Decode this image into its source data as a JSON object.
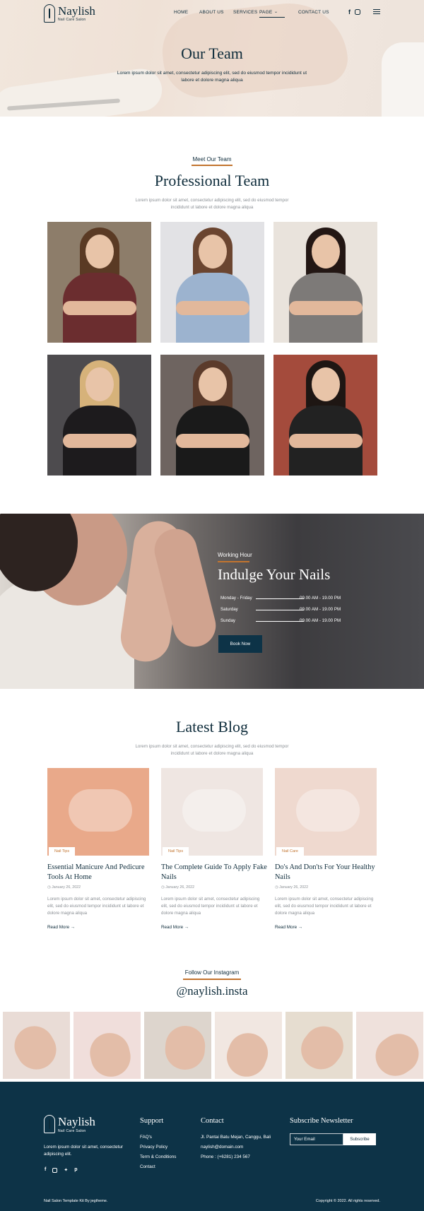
{
  "nav": {
    "logo_name": "Naylish",
    "logo_tagline": "Nail Care Salon",
    "items": [
      "HOME",
      "ABOUT US",
      "SERVICES",
      "PAGE",
      "CONTACT US"
    ],
    "active_item": "PAGE",
    "social_icons": [
      "facebook-icon",
      "instagram-icon"
    ]
  },
  "hero": {
    "title": "Our Team",
    "subtitle": "Lorem ipsum dolor sit amet, consectetur adipiscing elit, sed do eiusmod tempor incididunt ut labore et dolore magna aliqua"
  },
  "team": {
    "eyebrow": "Meet Our Team",
    "title": "Professional Team",
    "subtitle": "Lorem ipsum dolor sit amet, consectetur adipiscing elit, sed do eiusmod tempor incididunt ut labore et dolore magna aliqua",
    "members": [
      {
        "bg": "#8d7d6a",
        "hair": "#5a3a24",
        "outfit": "#6b2d2f"
      },
      {
        "bg": "#e2e2e5",
        "hair": "#6b4530",
        "outfit": "#9cb3cf"
      },
      {
        "bg": "#e9e3dc",
        "hair": "#231714",
        "outfit": "#7d7a78"
      },
      {
        "bg": "#4d4b4e",
        "hair": "#d6b27a",
        "outfit": "#1d1b1d"
      },
      {
        "bg": "#6e6460",
        "hair": "#5b3b2b",
        "outfit": "#1a1a1a"
      },
      {
        "bg": "#a44b3c",
        "hair": "#1e1613",
        "outfit": "#222"
      }
    ]
  },
  "working_hour": {
    "eyebrow": "Working Hour",
    "title": "Indulge Your Nails",
    "rows": [
      {
        "day": "Monday - Friday",
        "time": "09.00 AM - 19.00 PM"
      },
      {
        "day": "Saturday",
        "time": "09.00 AM - 19.00 PM"
      },
      {
        "day": "Sunday",
        "time": "09.00 AM - 19.00 PM"
      }
    ],
    "button": "Book Now"
  },
  "blog": {
    "title": "Latest Blog",
    "subtitle": "Lorem ipsum dolor sit amet, consectetur adipiscing elit, sed do eiusmod tempor incididunt ut labore et dolore magna aliqua",
    "posts": [
      {
        "tag": "Nail Tips",
        "title": "Essential Manicure And Pedicure Tools At Home",
        "date": "January 26, 2022",
        "desc": "Lorem ipsum dolor sit amet, consectetur adipiscing elit, sed do eiusmod tempor incididunt ut labore et dolore magna aliqua",
        "more": "Read More",
        "img": "#e9a98a"
      },
      {
        "tag": "Nail Tips",
        "title": "The Complete Guide To Apply Fake Nails",
        "date": "January 26, 2022",
        "desc": "Lorem ipsum dolor sit amet, consectetur adipiscing elit, sed do eiusmod tempor incididunt ut labore et dolore magna aliqua",
        "more": "Read More",
        "img": "#efe6e2"
      },
      {
        "tag": "Nail Care",
        "title": "Do's And Don'ts For Your Healthy Nails",
        "date": "January 26, 2022",
        "desc": "Lorem ipsum dolor sit amet, consectetur adipiscing elit, sed do eiusmod tempor incididunt ut labore et dolore magna aliqua",
        "more": "Read More",
        "img": "#efd9cf"
      }
    ]
  },
  "instagram": {
    "eyebrow": "Follow Our Instagram",
    "handle": "@naylish.insta",
    "tiles": [
      "#e9dcd6",
      "#f0dedb",
      "#ddd5cd",
      "#f1e7e1",
      "#e6ddd0",
      "#efe1dc"
    ]
  },
  "footer": {
    "logo_name": "Naylish",
    "logo_tagline": "Nail Care Salon",
    "about": "Lorem ipsum dolor sit amet, consectetur adipiscing elit.",
    "social_icons": [
      "facebook-icon",
      "instagram-icon",
      "twitter-icon",
      "pinterest-icon"
    ],
    "support_title": "Support",
    "support_links": [
      "FAQ's",
      "Privacy Policy",
      "Term & Conditions",
      "Contact"
    ],
    "contact_title": "Contact",
    "contact_lines": [
      "Jl. Pantai Batu Mejan, Canggu, Bali",
      "naylish@domain.com",
      "Phone : (+6281) 234 567"
    ],
    "newsletter_title": "Subscribe Newsletter",
    "email_placeholder": "Your Email",
    "subscribe_button": "Subscribe",
    "credit": "Nail Salon Template Kit By jegtheme.",
    "copyright": "Copyright © 2022. All rights reserved."
  },
  "colors": {
    "navy": "#0d3347",
    "accent": "#c2742f"
  }
}
